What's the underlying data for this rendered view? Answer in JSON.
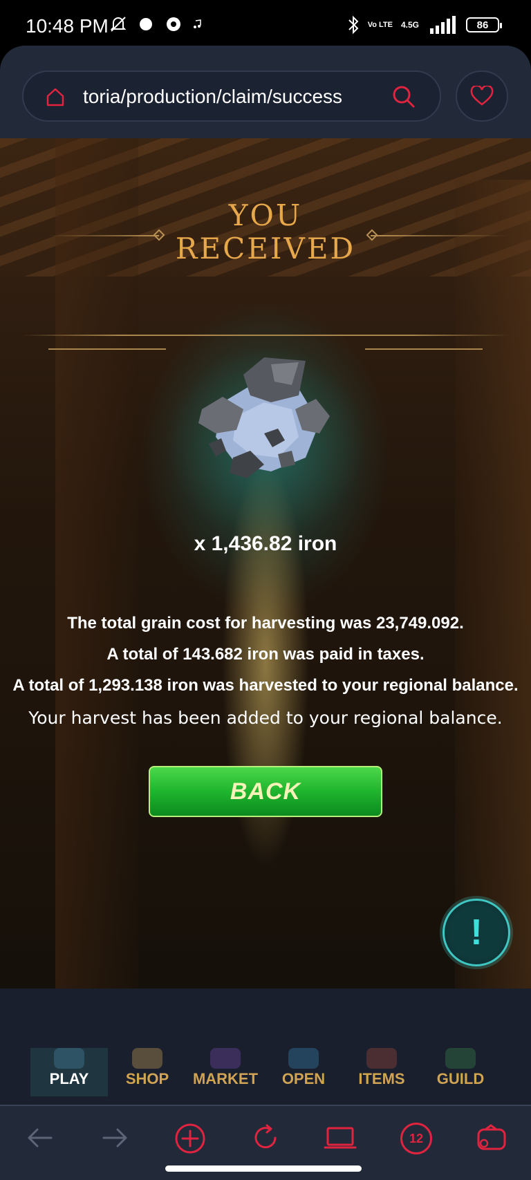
{
  "status_bar": {
    "time": "10:48 PM",
    "network": "4.5G",
    "volte": "Vo LTE",
    "battery": "86"
  },
  "browser": {
    "url": "toria/production/claim/success",
    "tabs_count": "12"
  },
  "page": {
    "title_line1": "YOU",
    "title_line2": "RECEIVED",
    "amount": "x 1,436.82 iron",
    "info_lines": [
      "The total grain cost for harvesting was 23,749.092.",
      "A total of 143.682 iron was paid in taxes.",
      "A total of 1,293.138 iron was harvested to your regional balance.",
      "Your harvest has been added to your regional balance."
    ],
    "back_label": "BACK",
    "alert_label": "!"
  },
  "nav": {
    "items": [
      {
        "label": "PLAY",
        "active": true
      },
      {
        "label": "SHOP",
        "active": false
      },
      {
        "label": "MARKET",
        "active": false
      },
      {
        "label": "OPEN",
        "active": false
      },
      {
        "label": "ITEMS",
        "active": false
      },
      {
        "label": "GUILD",
        "active": false
      }
    ]
  },
  "colors": {
    "accent_gold": "#e7a84b",
    "button_green": "#1fb52e",
    "browser_red": "#e0243f",
    "teal": "#3fc7c4"
  }
}
